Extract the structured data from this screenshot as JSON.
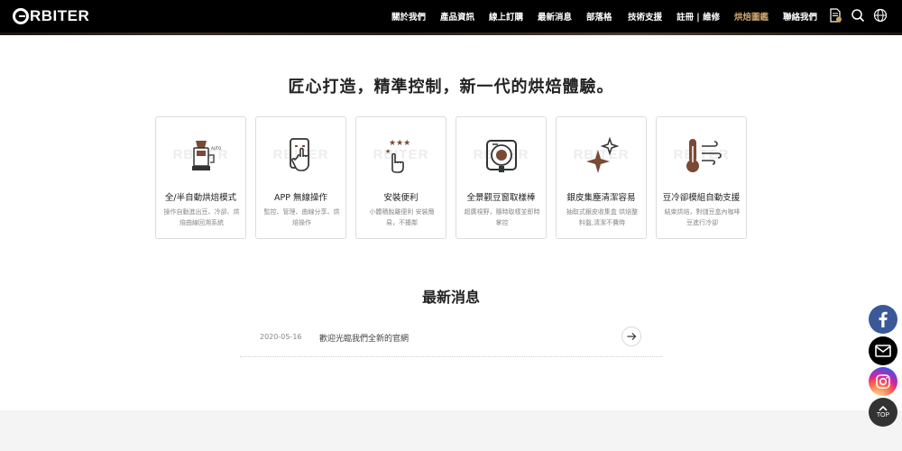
{
  "header": {
    "brand": "RBITER",
    "menu": [
      {
        "label": "關於我們"
      },
      {
        "label": "產品資訊"
      },
      {
        "label": "線上訂購"
      },
      {
        "label": "最新消息"
      },
      {
        "label": "部落格"
      },
      {
        "label": "技術支援"
      },
      {
        "label": "註冊 | 維修"
      },
      {
        "label": "烘焙圖鑑"
      },
      {
        "label": "聯絡我們"
      }
    ],
    "active_color": "#c9a46b",
    "icons": [
      "document-icon",
      "search-icon",
      "globe-icon"
    ]
  },
  "features": {
    "headline": "匠心打造，精準控制，新一代的烘焙體驗。",
    "watermark": "RBITER",
    "cards": [
      {
        "title": "全/半自動烘焙模式",
        "desc": "操作自動進出豆、冷卻、烘焙曲線回溯系統",
        "icon": "coffee-grinder-icon"
      },
      {
        "title": "APP 無線操作",
        "desc": "監控、管理、曲線分享、烘焙操作",
        "icon": "smartphone-touch-icon"
      },
      {
        "title": "安裝便利",
        "desc": "小體積脫離便利 安裝簡易，不擾鄰",
        "icon": "star-rating-hand-icon"
      },
      {
        "title": "全景觀豆窗取樣棒",
        "desc": "超廣視野，隨時取樣並即時掌控",
        "icon": "viewing-window-icon"
      },
      {
        "title": "銀皮集塵清潔容易",
        "desc": "抽取式銀皮收集盒 烘焙整料盤,清潔不費時",
        "icon": "sparkle-icon"
      },
      {
        "title": "豆冷卻模組自動支援",
        "desc": "結束烘焙，對儲豆盒內咖啡豆進行冷卻",
        "icon": "thermometer-wind-icon"
      }
    ]
  },
  "news": {
    "title": "最新消息",
    "items": [
      {
        "date": "2020-05-16",
        "text": "歡迎光臨我們全新的官網"
      }
    ]
  },
  "floating": {
    "top_label": "TOP",
    "colors": {
      "facebook": "#3b5998",
      "mail": "#000000",
      "top": "#333333"
    }
  }
}
